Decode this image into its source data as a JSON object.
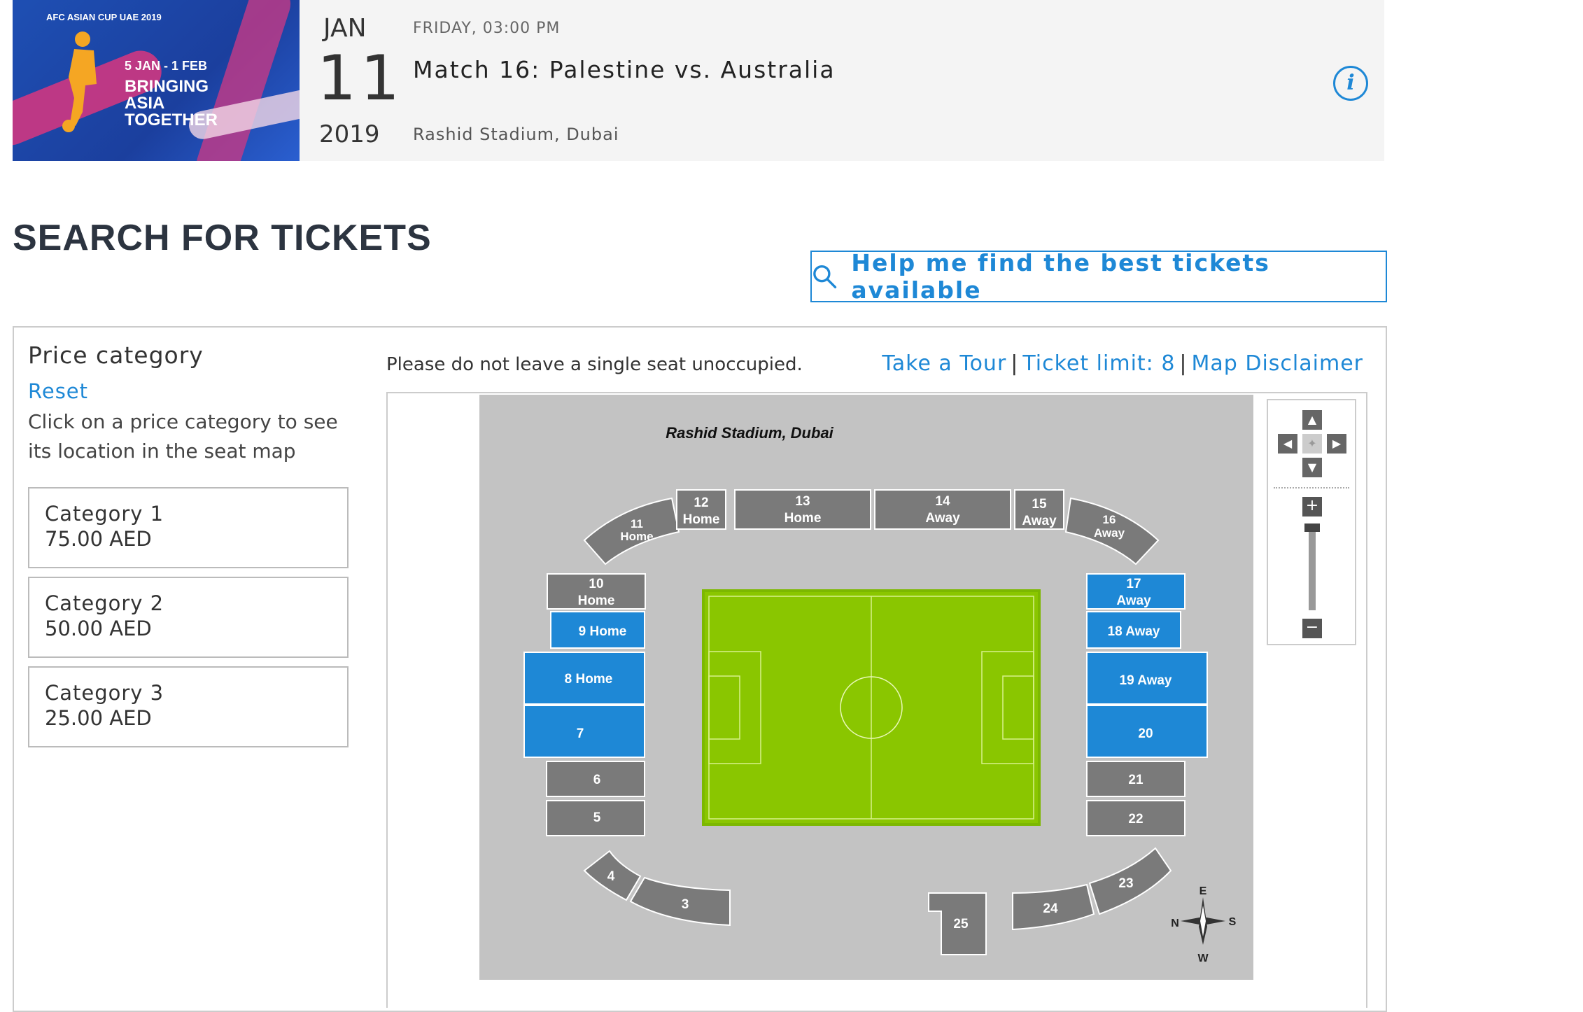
{
  "banner": {
    "logo_text": "AFC ASIAN CUP UAE 2019",
    "dates": "5 JAN - 1 FEB",
    "tagline": [
      "BRINGING",
      "ASIA",
      "TOGETHER"
    ]
  },
  "event": {
    "month": "JAN",
    "day": "11",
    "year": "2019",
    "when": "FRIDAY, 03:00 PM",
    "title": "Match 16: Palestine vs. Australia",
    "venue": "Rashid Stadium, Dubai"
  },
  "search": {
    "heading": "SEARCH FOR TICKETS",
    "help_button": "Help me find the best tickets available"
  },
  "price_panel": {
    "title": "Price category",
    "reset": "Reset",
    "help_text": "Click on a price category to see its location in the seat map",
    "categories": [
      {
        "name": "Category 1",
        "price": "75.00 AED"
      },
      {
        "name": "Category 2",
        "price": "50.00 AED"
      },
      {
        "name": "Category 3",
        "price": "25.00 AED"
      }
    ]
  },
  "map_header": {
    "notice": "Please do not leave a single seat unoccupied.",
    "take_tour": "Take a Tour",
    "ticket_limit": "Ticket limit: 8",
    "disclaimer": "Map Disclaimer",
    "separator": "|"
  },
  "seat_map": {
    "title": "Rashid Stadium, Dubai",
    "colors": {
      "available": "#1e88d6",
      "unavailable": "#7a7a7a",
      "pitch": "#8ac600",
      "background": "#c3c3c3"
    },
    "sections": [
      {
        "id": "3",
        "label": "3",
        "available": false
      },
      {
        "id": "4",
        "label": "4",
        "available": false
      },
      {
        "id": "5",
        "label": "5",
        "available": false
      },
      {
        "id": "6",
        "label": "6",
        "available": false
      },
      {
        "id": "7",
        "label": "7",
        "available": true
      },
      {
        "id": "8",
        "label": "8 Home",
        "available": true
      },
      {
        "id": "9",
        "label": "9 Home",
        "available": true
      },
      {
        "id": "10",
        "label": "10 Home",
        "available": false
      },
      {
        "id": "11",
        "label": "11 Home",
        "available": false
      },
      {
        "id": "12",
        "label": "12 Home",
        "available": false
      },
      {
        "id": "13",
        "label": "13 Home",
        "available": false
      },
      {
        "id": "14",
        "label": "14 Away",
        "available": false
      },
      {
        "id": "15",
        "label": "15 Away",
        "available": false
      },
      {
        "id": "16",
        "label": "16 Away",
        "available": false
      },
      {
        "id": "17",
        "label": "17 Away",
        "available": true
      },
      {
        "id": "18",
        "label": "18 Away",
        "available": true
      },
      {
        "id": "19",
        "label": "19 Away",
        "available": true
      },
      {
        "id": "20",
        "label": "20",
        "available": true
      },
      {
        "id": "21",
        "label": "21",
        "available": false
      },
      {
        "id": "22",
        "label": "22",
        "available": false
      },
      {
        "id": "23",
        "label": "23",
        "available": false
      },
      {
        "id": "24",
        "label": "24",
        "available": false
      },
      {
        "id": "25",
        "label": "25",
        "available": false
      }
    ],
    "compass": {
      "n": "N",
      "e": "E",
      "s": "S",
      "w": "W"
    }
  },
  "map_controls": {
    "up": "▲",
    "down": "▼",
    "left": "◀",
    "right": "▶",
    "center": "✦",
    "zoom_in": "+",
    "zoom_out": "−"
  }
}
